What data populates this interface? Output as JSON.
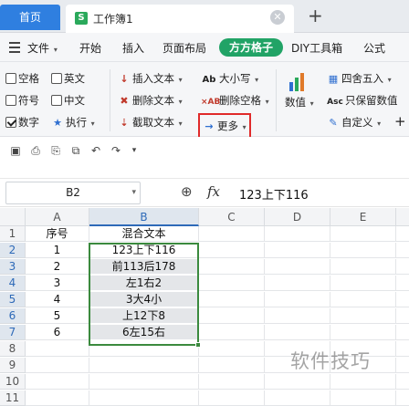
{
  "tabs": {
    "home": "首页",
    "workbook": "工作簿1",
    "workbook_icon": "S"
  },
  "menu": {
    "file": "文件",
    "items": [
      "开始",
      "插入",
      "页面布局",
      "方方格子",
      "DIY工具箱",
      "公式"
    ]
  },
  "ribbon": {
    "opt_space": "空格",
    "opt_english": "英文",
    "opt_symbol": "符号",
    "opt_chinese": "中文",
    "opt_number": "数字",
    "opt_number_checked": true,
    "execute": "执行",
    "insert_text": "插入文本",
    "delete_text": "删除文本",
    "extract_text": "截取文本",
    "case": "大小写",
    "delete_space": "删除空格",
    "more": "更多",
    "numeric": "数值",
    "round": "四舍五入",
    "keep_value": "只保留数值",
    "custom": "自定义"
  },
  "formula_bar": {
    "cell_ref": "B2",
    "fx": "fx",
    "value": "123上下116"
  },
  "sheet": {
    "columns": [
      "A",
      "B",
      "C",
      "D",
      "E"
    ],
    "selected_col": "B",
    "rows": [
      "1",
      "2",
      "3",
      "4",
      "5",
      "6",
      "7",
      "8",
      "9",
      "10",
      "11"
    ],
    "headers": [
      "序号",
      "混合文本"
    ],
    "data": [
      [
        "1",
        "123上下116"
      ],
      [
        "2",
        "前113后178"
      ],
      [
        "3",
        "左1右2"
      ],
      [
        "4",
        "3大4小"
      ],
      [
        "5",
        "上12下8"
      ],
      [
        "6",
        "6左15右"
      ]
    ]
  },
  "watermark": "软件技巧"
}
